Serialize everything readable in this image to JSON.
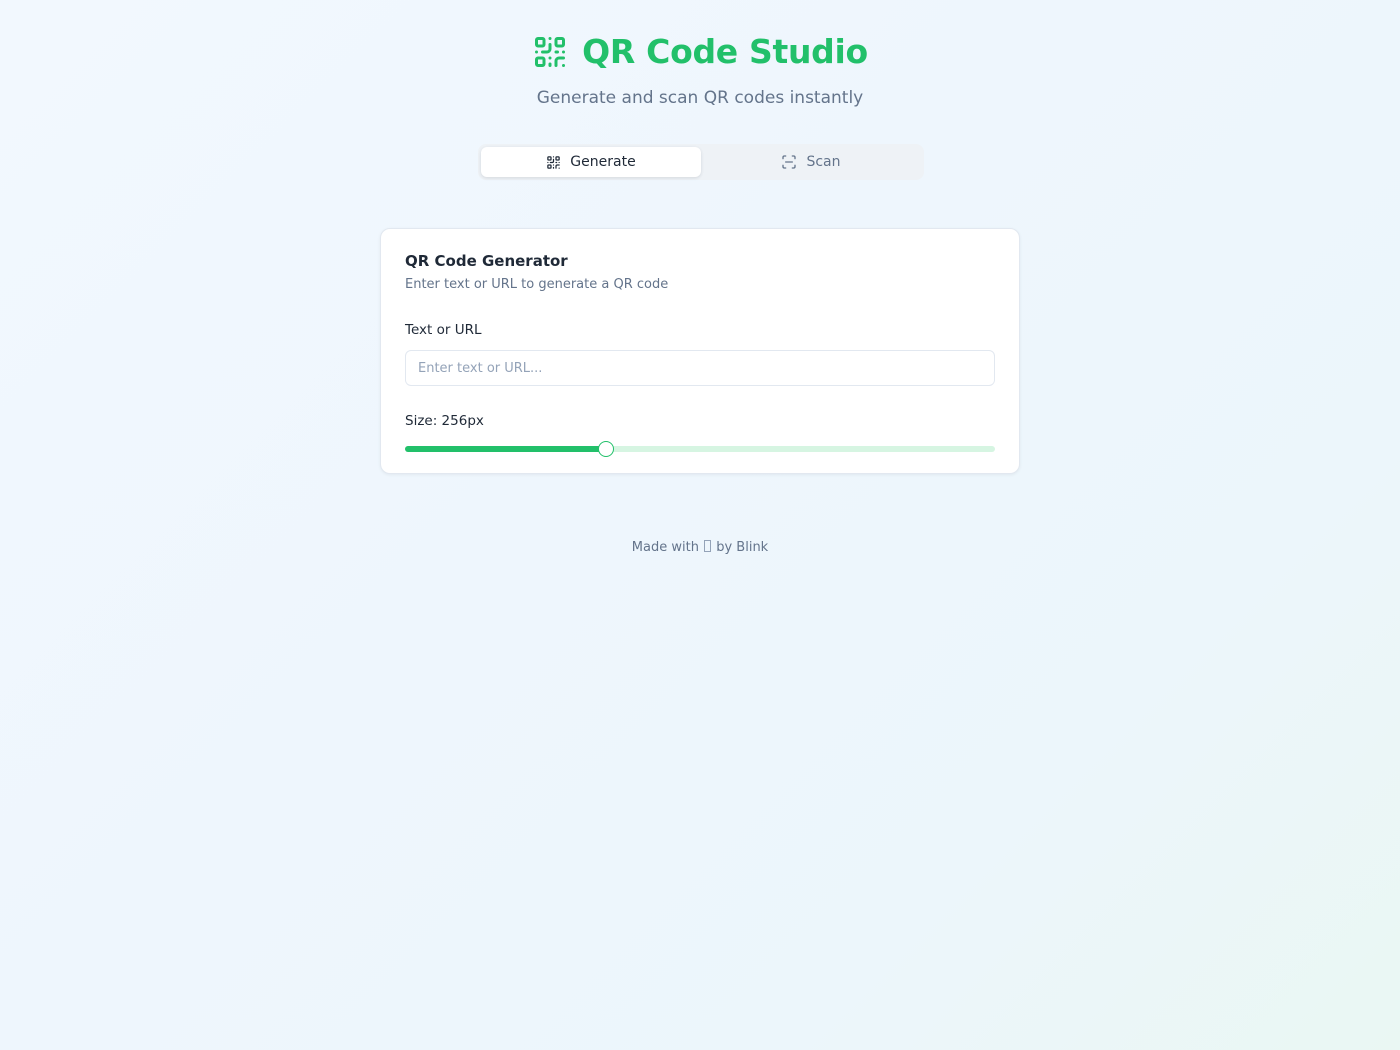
{
  "header": {
    "title": "QR Code Studio",
    "subtitle": "Generate and scan QR codes instantly",
    "logo_icon": "qr-code-icon"
  },
  "tabs": [
    {
      "label": "Generate",
      "icon": "qr-code-icon",
      "active": true
    },
    {
      "label": "Scan",
      "icon": "scan-icon",
      "active": false
    }
  ],
  "generator": {
    "title": "QR Code Generator",
    "description": "Enter text or URL to generate a QR code",
    "input_label": "Text or URL",
    "input_value": "",
    "input_placeholder": "Enter text or URL...",
    "size_label": "Size: 256px",
    "size_fraction": 0.34
  },
  "footer": {
    "prefix": "Made with",
    "suffix": "by Blink"
  },
  "colors": {
    "accent": "#22c06a",
    "accent_light": "#d6f5e2",
    "text_muted": "#64748b"
  }
}
